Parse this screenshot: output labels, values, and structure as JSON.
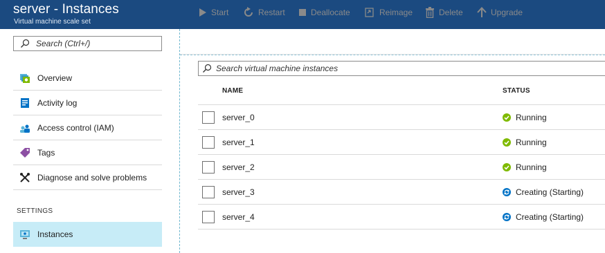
{
  "header": {
    "title": "server - Instances",
    "subtitle": "Virtual machine scale set"
  },
  "sidebar": {
    "search_placeholder": "Search (Ctrl+/)",
    "items": [
      {
        "label": "Overview",
        "icon": "overview-icon"
      },
      {
        "label": "Activity log",
        "icon": "activity-log-icon"
      },
      {
        "label": "Access control (IAM)",
        "icon": "access-control-icon"
      },
      {
        "label": "Tags",
        "icon": "tag-icon"
      },
      {
        "label": "Diagnose and solve problems",
        "icon": "wrench-icon"
      }
    ],
    "section_settings": "SETTINGS",
    "settings_items": [
      {
        "label": "Instances",
        "icon": "instances-icon",
        "active": true
      }
    ]
  },
  "toolbar": {
    "start": "Start",
    "restart": "Restart",
    "deallocate": "Deallocate",
    "reimage": "Reimage",
    "delete": "Delete",
    "upgrade": "Upgrade"
  },
  "content": {
    "search_placeholder": "Search virtual machine instances",
    "columns": {
      "name": "NAME",
      "status": "STATUS"
    },
    "rows": [
      {
        "name": "server_0",
        "status": "Running",
        "state": "running"
      },
      {
        "name": "server_1",
        "status": "Running",
        "state": "running"
      },
      {
        "name": "server_2",
        "status": "Running",
        "state": "running"
      },
      {
        "name": "server_3",
        "status": "Creating (Starting)",
        "state": "creating"
      },
      {
        "name": "server_4",
        "status": "Creating (Starting)",
        "state": "creating"
      }
    ]
  },
  "colors": {
    "header_bg": "#1b4a80",
    "active_nav_bg": "#c7ecf7",
    "running_green": "#7fba00",
    "creating_blue": "#0072c6",
    "toolbar_disabled": "#8a8a8a"
  }
}
